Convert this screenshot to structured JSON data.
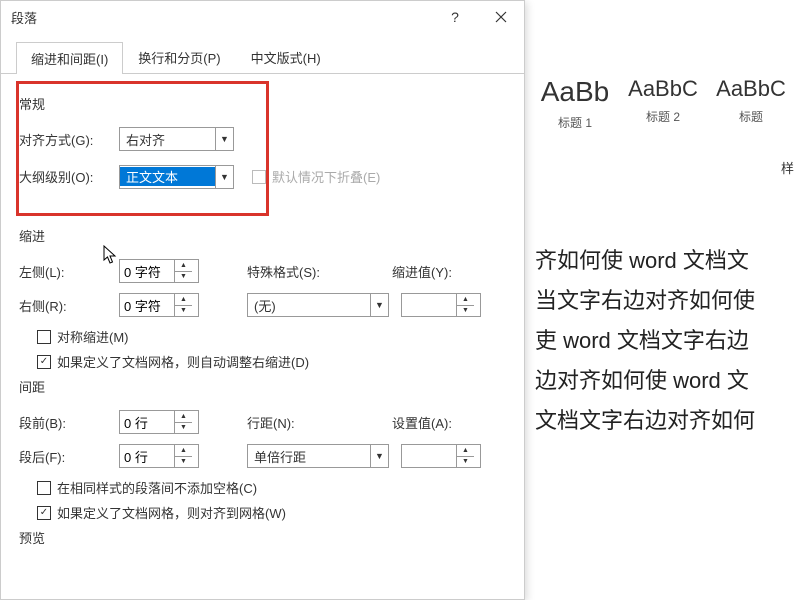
{
  "dialog": {
    "title": "段落",
    "tabs": {
      "indent": "缩进和间距(I)",
      "pagination": "换行和分页(P)",
      "asian": "中文版式(H)"
    },
    "general": {
      "label": "常规",
      "alignment_label": "对齐方式(G):",
      "alignment_value": "右对齐",
      "outline_label": "大纲级别(O):",
      "outline_value": "正文文本",
      "collapsed_label": "默认情况下折叠(E)"
    },
    "indent": {
      "label": "缩进",
      "left_label": "左侧(L):",
      "left_value": "0 字符",
      "right_label": "右侧(R):",
      "right_value": "0 字符",
      "special_label": "特殊格式(S):",
      "special_value": "(无)",
      "indent_value_label": "缩进值(Y):",
      "mirror_label": "对称缩进(M)",
      "grid_adjust_label": "如果定义了文档网格，则自动调整右缩进(D)"
    },
    "spacing": {
      "label": "间距",
      "before_label": "段前(B):",
      "before_value": "0 行",
      "after_label": "段后(F):",
      "after_value": "0 行",
      "line_label": "行距(N):",
      "line_value": "单倍行距",
      "set_label": "设置值(A):",
      "nospace_label": "在相同样式的段落间不添加空格(C)",
      "snap_label": "如果定义了文档网格，则对齐到网格(W)"
    },
    "preview_label": "预览"
  },
  "background": {
    "styles": [
      {
        "sample": "AaBb",
        "name": "标题 1"
      },
      {
        "sample": "AaBbC",
        "name": "标题 2"
      },
      {
        "sample": "AaBbC",
        "name": "标题"
      }
    ],
    "styles_btn": "样",
    "doc_lines": [
      "齐如何使 word 文档文",
      "当文字右边对齐如何使",
      "吏 word 文档文字右边",
      "边对齐如何使 word 文",
      "文档文字右边对齐如何"
    ]
  }
}
